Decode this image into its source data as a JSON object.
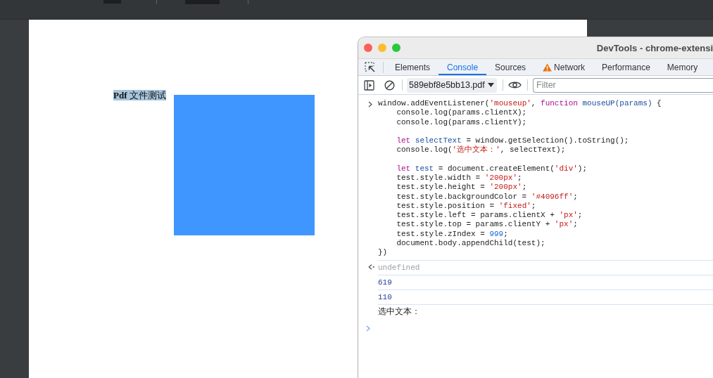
{
  "pdf_page": {
    "heading": {
      "text": "**Pdf** 文件测试",
      "selected": true
    }
  },
  "devtools": {
    "title": "DevTools - chrome-extensi",
    "tabs": [
      {
        "label": "Elements",
        "selected": false,
        "warning": false
      },
      {
        "label": "Console",
        "selected": true,
        "warning": false
      },
      {
        "label": "Sources",
        "selected": false,
        "warning": false
      },
      {
        "label": "Network",
        "selected": false,
        "warning": true
      },
      {
        "label": "Performance",
        "selected": false,
        "warning": false
      },
      {
        "label": "Memory",
        "selected": false,
        "warning": false
      }
    ],
    "context": "589ebf8e5bb13.pdf",
    "filter": {
      "placeholder": "Filter"
    },
    "console": [
      {
        "kind": "input",
        "head": [
          {
            "kind": "plain",
            "text": "window.addEventListener("
          },
          {
            "kind": "string",
            "text": "'mouseup'"
          },
          {
            "kind": "plain",
            "text": ", "
          },
          {
            "kind": "keyword",
            "text": "function "
          },
          {
            "kind": "name",
            "text": "mouseUP(params)"
          },
          {
            "kind": "plain",
            "text": " {"
          }
        ],
        "blocks": [
          [
            [
              {
                "kind": "plain",
                "text": "console.log(params.clientX);"
              }
            ],
            [
              {
                "kind": "plain",
                "text": "console.log(params.clientY);"
              }
            ]
          ],
          [
            [
              {
                "kind": "keyword",
                "text": "let "
              },
              {
                "kind": "name",
                "text": "selectText"
              },
              {
                "kind": "plain",
                "text": " = window.getSelection().toString();"
              }
            ],
            [
              {
                "kind": "plain",
                "text": "console.log("
              },
              {
                "kind": "string",
                "text": "'选中文本：'"
              },
              {
                "kind": "plain",
                "text": ", selectText);"
              }
            ]
          ],
          [
            [
              {
                "kind": "keyword",
                "text": "let "
              },
              {
                "kind": "name",
                "text": "test"
              },
              {
                "kind": "plain",
                "text": " = document.createElement("
              },
              {
                "kind": "string",
                "text": "'div'"
              },
              {
                "kind": "plain",
                "text": ");"
              }
            ],
            [
              {
                "kind": "plain",
                "text": "test.style.width = "
              },
              {
                "kind": "string",
                "text": "'200px'"
              },
              {
                "kind": "plain",
                "text": ";"
              }
            ],
            [
              {
                "kind": "plain",
                "text": "test.style.height = "
              },
              {
                "kind": "string",
                "text": "'200px'"
              },
              {
                "kind": "plain",
                "text": ";"
              }
            ],
            [
              {
                "kind": "plain",
                "text": "test.style.backgroundColor = "
              },
              {
                "kind": "string",
                "text": "'#4096ff'"
              },
              {
                "kind": "plain",
                "text": ";"
              }
            ],
            [
              {
                "kind": "plain",
                "text": "test.style.position = "
              },
              {
                "kind": "string",
                "text": "'fixed'"
              },
              {
                "kind": "plain",
                "text": ";"
              }
            ],
            [
              {
                "kind": "plain",
                "text": "test.style.left = params.clientX + "
              },
              {
                "kind": "string",
                "text": "'px'"
              },
              {
                "kind": "plain",
                "text": ";"
              }
            ],
            [
              {
                "kind": "plain",
                "text": "test.style.top = params.clientY + "
              },
              {
                "kind": "string",
                "text": "'px'"
              },
              {
                "kind": "plain",
                "text": ";"
              }
            ],
            [
              {
                "kind": "plain",
                "text": "test.style.zIndex = "
              },
              {
                "kind": "number",
                "text": "999"
              },
              {
                "kind": "plain",
                "text": ";"
              }
            ],
            [
              {
                "kind": "plain",
                "text": "document.body.appendChild(test);"
              }
            ]
          ]
        ],
        "tail": [
          {
            "kind": "plain",
            "text": "})"
          }
        ]
      },
      {
        "kind": "return",
        "text": "undefined"
      },
      {
        "kind": "number",
        "text": "619"
      },
      {
        "kind": "number",
        "text": "110"
      },
      {
        "kind": "log",
        "text": "选中文本："
      }
    ]
  }
}
